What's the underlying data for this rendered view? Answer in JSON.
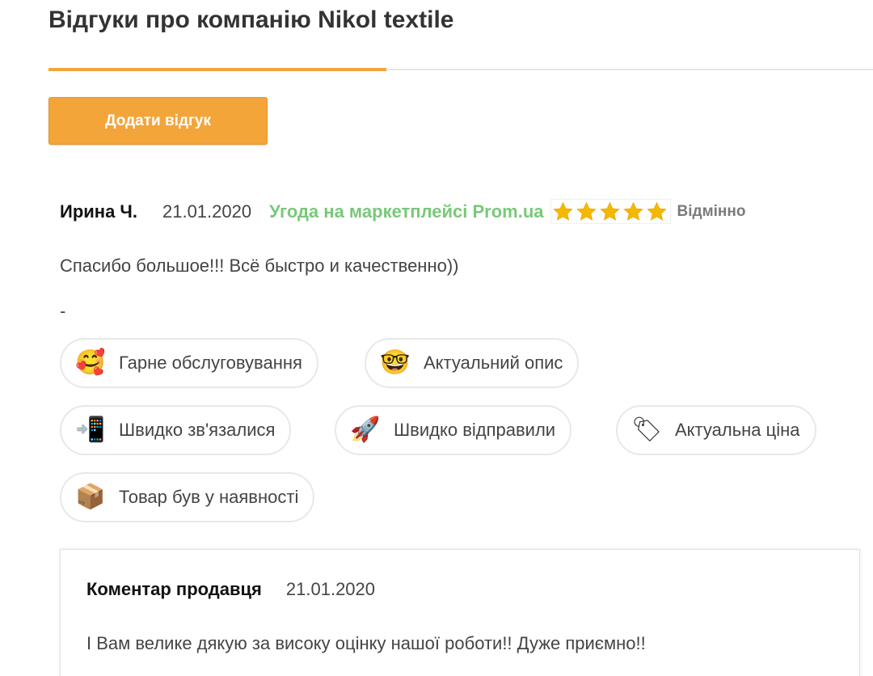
{
  "header": {
    "title": "Відгуки про компанію Nikol textile"
  },
  "actions": {
    "add_review_label": "Додати відгук"
  },
  "review": {
    "author": "Ирина Ч.",
    "date": "21.01.2020",
    "marketplace": "Угода на маркетплейсі Prom.ua",
    "rating": 5,
    "rating_max": 5,
    "rating_label": "Відмінно",
    "text": "Спасибо большое!!! Всё быстро и качественно))",
    "secondary_text": "-",
    "tags": [
      {
        "emoji": "🥰",
        "icon": "smiling-face-with-hearts-icon",
        "label": "Гарне обслуговування"
      },
      {
        "emoji": "🤓",
        "icon": "nerd-face-icon",
        "label": "Актуальний опис"
      },
      {
        "emoji": "📲",
        "icon": "mobile-phone-arrow-icon",
        "label": "Швидко зв'язалися"
      },
      {
        "emoji": "🚀",
        "icon": "rocket-icon",
        "label": "Швидко відправили"
      },
      {
        "emoji": "🏷",
        "icon": "price-tag-icon",
        "label": "Актуальна ціна"
      },
      {
        "emoji": "📦",
        "icon": "package-icon",
        "label": "Товар був у наявності"
      }
    ]
  },
  "seller_comment": {
    "label": "Коментар продавця",
    "date": "21.01.2020",
    "text": "І Вам велике дякую за високу оцінку нашої роботи!! Дуже приємно!!"
  },
  "colors": {
    "accent": "#f3a53a",
    "marketplace_green": "#79c879",
    "star_yellow": "#f5b800"
  }
}
